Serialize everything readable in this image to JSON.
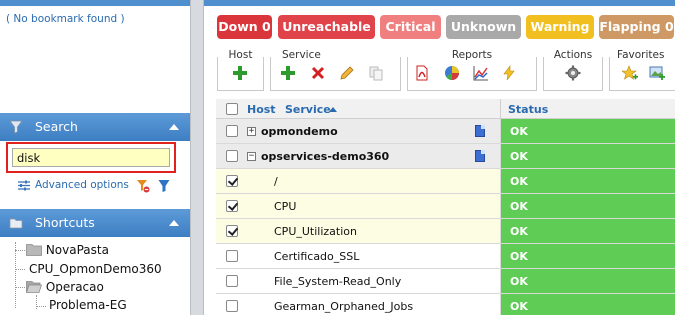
{
  "sidebar": {
    "bookmarks": {
      "empty_text": "( No bookmark found )"
    },
    "search": {
      "title": "Search",
      "input_value": "disk",
      "advanced_label": "Advanced options"
    },
    "shortcuts": {
      "title": "Shortcuts",
      "tree": [
        {
          "label": "NovaPasta",
          "type": "folder"
        },
        {
          "label": "CPU_OpmonDemo360",
          "type": "item"
        },
        {
          "label": "Operacao",
          "type": "folder-open"
        },
        {
          "label": "Problema-EG",
          "type": "item"
        }
      ]
    }
  },
  "status_badges": [
    {
      "label": "Down 0",
      "color": "#d9353a"
    },
    {
      "label": "Unreachable 0",
      "color": "#e1434b"
    },
    {
      "label": "Critical 0",
      "color": "#f08080"
    },
    {
      "label": "Unknown 0",
      "color": "#a9a9a9"
    },
    {
      "label": "Warning 0",
      "color": "#f2bf20"
    },
    {
      "label": "Flapping 0",
      "color": "#cf9966"
    }
  ],
  "toolbar": {
    "groups": [
      {
        "label": "Host",
        "buttons": [
          "add-icon"
        ]
      },
      {
        "label": "Service",
        "buttons": [
          "add-icon",
          "delete-icon",
          "edit-icon",
          "copy-icon"
        ]
      },
      {
        "label": "Reports",
        "buttons": [
          "pdf-icon",
          "pie-chart-icon",
          "line-chart-icon",
          "lightning-icon"
        ]
      },
      {
        "label": "Actions",
        "buttons": [
          "gear-icon"
        ]
      },
      {
        "label": "Favorites",
        "buttons": [
          "star-add-icon",
          "image-add-icon"
        ]
      }
    ]
  },
  "grid": {
    "columns": {
      "host": "Host",
      "service": "Service",
      "status": "Status"
    },
    "rows": [
      {
        "kind": "group",
        "name": "opmondemo",
        "toggle": "+",
        "checked": false,
        "status": "OK"
      },
      {
        "kind": "group",
        "name": "opservices-demo360",
        "toggle": "−",
        "checked": false,
        "status": "OK"
      },
      {
        "kind": "service",
        "name": "/",
        "checked": true,
        "status": "OK"
      },
      {
        "kind": "service",
        "name": "CPU",
        "checked": true,
        "status": "OK"
      },
      {
        "kind": "service",
        "name": "CPU_Utilization",
        "checked": true,
        "status": "OK"
      },
      {
        "kind": "service",
        "name": "Certificado_SSL",
        "checked": false,
        "status": "OK"
      },
      {
        "kind": "service",
        "name": "File_System-Read_Only",
        "checked": false,
        "status": "OK"
      },
      {
        "kind": "service",
        "name": "Gearman_Orphaned_Jobs",
        "checked": false,
        "status": "OK"
      }
    ]
  }
}
